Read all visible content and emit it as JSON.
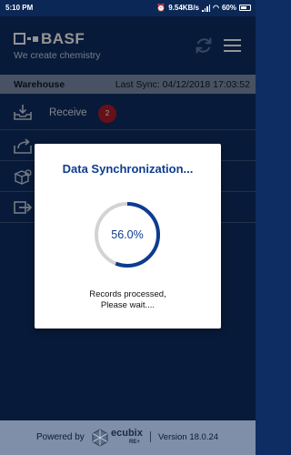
{
  "status_bar": {
    "time": "5:10 PM",
    "network_speed": "9.54KB/s",
    "battery": "60%"
  },
  "header": {
    "brand": "BASF",
    "tagline": "We create chemistry",
    "sync_icon": "sync-icon",
    "menu_icon": "hamburger-menu-icon"
  },
  "warehouse_bar": {
    "title": "Warehouse",
    "last_sync": "Last Sync: 04/12/2018 17:03:52"
  },
  "menu": {
    "items": [
      {
        "label": "Receive",
        "icon": "inbox-download-icon",
        "badge": "2"
      },
      {
        "label": "",
        "icon": "outbox-upload-icon"
      },
      {
        "label": "",
        "icon": "boxes-icon"
      },
      {
        "label": "",
        "icon": "transfer-icon"
      }
    ]
  },
  "dialog": {
    "title": "Data Synchronization...",
    "progress_text": "56.0%",
    "progress_fraction": 0.56,
    "message_line1": "Records processed,",
    "message_line2": "Please wait....",
    "accent": "#0d3c91"
  },
  "footer": {
    "powered_by": "Powered by",
    "vendor_name": "ecubix",
    "vendor_sub": "RE+",
    "version": "Version 18.0.24"
  }
}
